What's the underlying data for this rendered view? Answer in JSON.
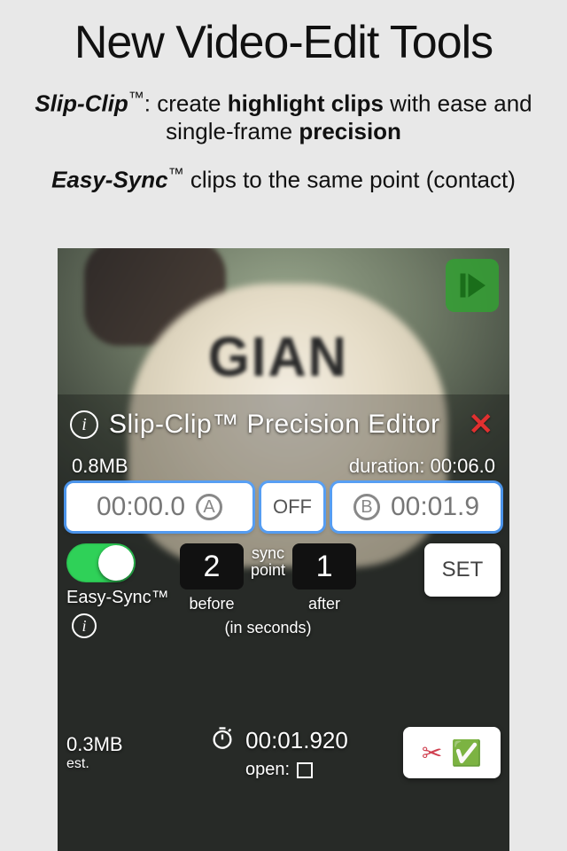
{
  "header": {
    "title": "New Video-Edit Tools"
  },
  "features": {
    "slip_clip_lead": "Slip-Clip",
    "slip_clip_tm": "™",
    "slip_clip_after": ": create ",
    "slip_clip_strong1": "highlight clips",
    "slip_clip_mid": " with ease and single-frame ",
    "slip_clip_strong2": "precision",
    "easy_sync_lead": "Easy-Sync",
    "easy_sync_tm": "™",
    "easy_sync_after": " clips to the same point (contact)"
  },
  "video": {
    "jersey_text": "GIAN"
  },
  "editor": {
    "title": "Slip-Clip™ Precision Editor",
    "file_size": "0.8MB",
    "duration_label": "duration: 00:06.0",
    "point_a": "00:00.0",
    "ab_toggle": "OFF",
    "point_b": "00:01.9",
    "toggle_label": "Easy-Sync™",
    "seconds_before": "2",
    "sync_point_top": "sync",
    "sync_point_bottom": "point",
    "before_label": "before",
    "seconds_after": "1",
    "after_label": "after",
    "in_seconds_label": "(in seconds)",
    "set_label": "SET",
    "est_size": "0.3MB",
    "est_label": "est.",
    "sync_time": "00:01.920",
    "open_label": "open:",
    "scissors": "✂",
    "check": "✅"
  }
}
